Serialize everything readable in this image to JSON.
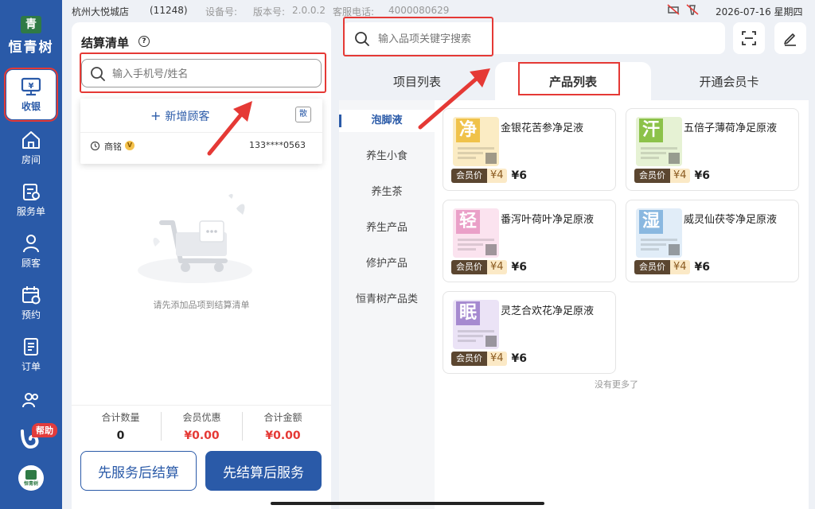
{
  "status": {
    "store": "杭州大悦城店",
    "store_code": "(11248)",
    "device_label": "设备号:",
    "version_label": "版本号:",
    "version": "2.0.0.2",
    "service_label": "客服电话:",
    "service_phone": "4000080629",
    "datetime": "2026-07-16 星期四"
  },
  "brand": {
    "logo_char": "青",
    "name": "恒青树"
  },
  "nav": {
    "items": [
      {
        "label": "收银",
        "icon": "cashier-icon"
      },
      {
        "label": "房间",
        "icon": "home-icon"
      },
      {
        "label": "服务单",
        "icon": "service-order-icon"
      },
      {
        "label": "顾客",
        "icon": "customer-icon"
      },
      {
        "label": "预约",
        "icon": "calendar-icon"
      },
      {
        "label": "订单",
        "icon": "order-icon"
      }
    ],
    "help_label": "帮助",
    "bottom_logo_text": "恒青树"
  },
  "checkout": {
    "title": "结算清单",
    "search_placeholder": "输入手机号/姓名",
    "add_customer": "新增顾客",
    "scan_label": "散",
    "recent_customer": {
      "name": "商铭",
      "level": "V",
      "phone": "133****0563"
    },
    "empty_text": "请先添加品项到结算清单",
    "stats": [
      {
        "label": "合计数量",
        "value": "0"
      },
      {
        "label": "会员优惠",
        "value": "¥0.00"
      },
      {
        "label": "合计金额",
        "value": "¥0.00"
      }
    ],
    "btn_service_first": "先服务后结算",
    "btn_pay_first": "先结算后服务"
  },
  "products": {
    "search_placeholder": "输入品项关键字搜索",
    "tabs": [
      "项目列表",
      "产品列表",
      "开通会员卡"
    ],
    "active_tab": 1,
    "categories": [
      "泡脚液",
      "养生小食",
      "养生茶",
      "养生产品",
      "修护产品",
      "恒青树产品类"
    ],
    "active_category": 0,
    "items": [
      {
        "name": "金银花苦参净足液",
        "char": "净",
        "color": "#f0c24a",
        "bg": "#fbecc4",
        "member_tag": "会员价",
        "member_price": "¥4",
        "price": "¥6"
      },
      {
        "name": "五倍子薄荷净足原液",
        "char": "汗",
        "color": "#8cc24a",
        "bg": "#e6f2d4",
        "member_tag": "会员价",
        "member_price": "¥4",
        "price": "¥6"
      },
      {
        "name": "番泻叶荷叶净足原液",
        "char": "轻",
        "color": "#eaa0c8",
        "bg": "#fbe3ef",
        "member_tag": "会员价",
        "member_price": "¥4",
        "price": "¥6"
      },
      {
        "name": "威灵仙茯苓净足原液",
        "char": "湿",
        "color": "#8ab8e0",
        "bg": "#e1edf8",
        "member_tag": "会员价",
        "member_price": "¥4",
        "price": "¥6"
      },
      {
        "name": "灵芝合欢花净足原液",
        "char": "眠",
        "color": "#a68ad0",
        "bg": "#ebe3f6",
        "member_tag": "会员价",
        "member_price": "¥4",
        "price": "¥6"
      }
    ],
    "no_more": "没有更多了"
  }
}
